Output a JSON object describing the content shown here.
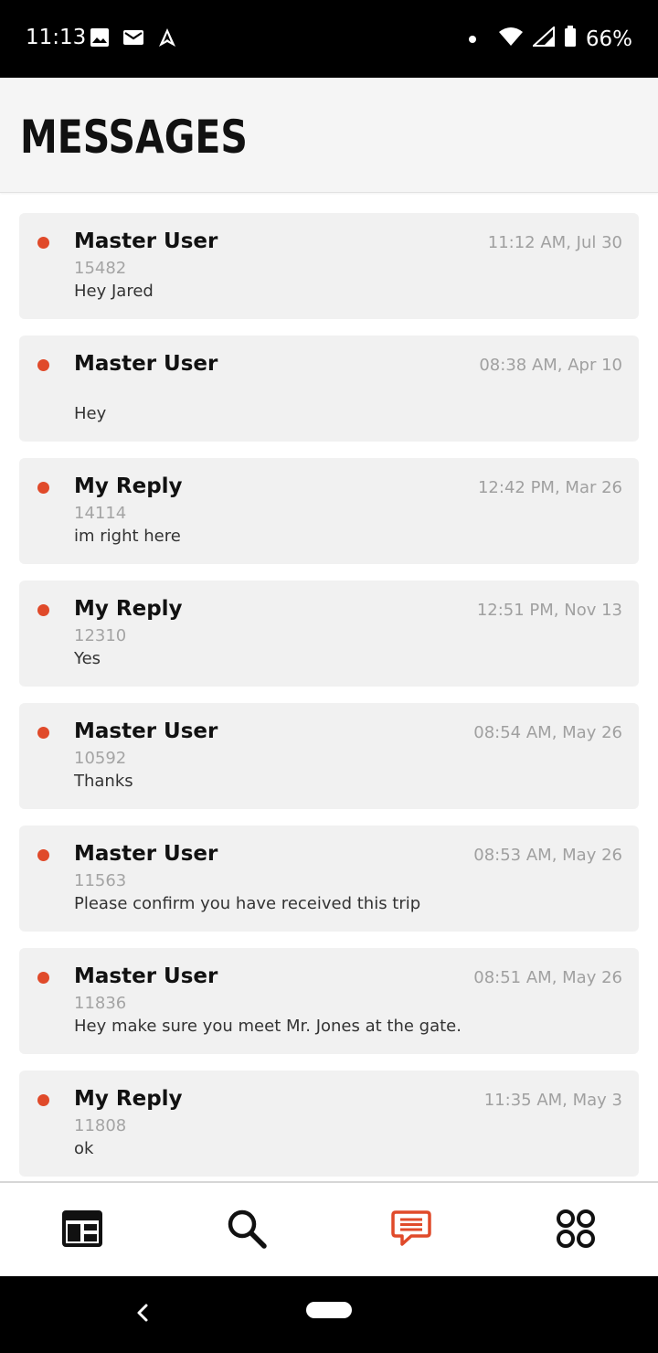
{
  "status_bar": {
    "time": "11:13",
    "battery": "66%",
    "icons": [
      "image-icon",
      "mail-icon",
      "navigation-icon",
      "dot-icon",
      "wifi-icon",
      "signal-icon",
      "battery-icon"
    ]
  },
  "header": {
    "title": "MESSAGES"
  },
  "colors": {
    "accent": "#e04a2a",
    "card_bg": "#f1f1f1",
    "header_bg": "#f5f5f5"
  },
  "messages": [
    {
      "sender": "Master User",
      "id": "15482",
      "text": "Hey Jared",
      "time": "11:12 AM, Jul 30"
    },
    {
      "sender": "Master User",
      "id": "",
      "text": "Hey",
      "time": "08:38 AM, Apr 10"
    },
    {
      "sender": "My Reply",
      "id": "14114",
      "text": "im right here",
      "time": "12:42 PM, Mar 26"
    },
    {
      "sender": "My Reply",
      "id": "12310",
      "text": "Yes",
      "time": "12:51 PM, Nov 13"
    },
    {
      "sender": "Master User",
      "id": "10592",
      "text": "Thanks",
      "time": "08:54 AM, May 26"
    },
    {
      "sender": "Master User",
      "id": "11563",
      "text": "Please confirm you have received this trip",
      "time": "08:53 AM, May 26"
    },
    {
      "sender": "Master User",
      "id": "11836",
      "text": "Hey make sure you meet Mr. Jones at the gate.",
      "time": "08:51 AM, May 26"
    },
    {
      "sender": "My Reply",
      "id": "11808",
      "text": "ok",
      "time": "11:35 AM, May 3"
    }
  ],
  "bottom_nav": {
    "items": [
      {
        "icon": "dashboard-icon",
        "active": false
      },
      {
        "icon": "search-icon",
        "active": false
      },
      {
        "icon": "messages-icon",
        "active": true
      },
      {
        "icon": "apps-icon",
        "active": false
      }
    ]
  },
  "system_nav": {
    "icons": [
      "back-icon",
      "home-pill-icon"
    ]
  }
}
